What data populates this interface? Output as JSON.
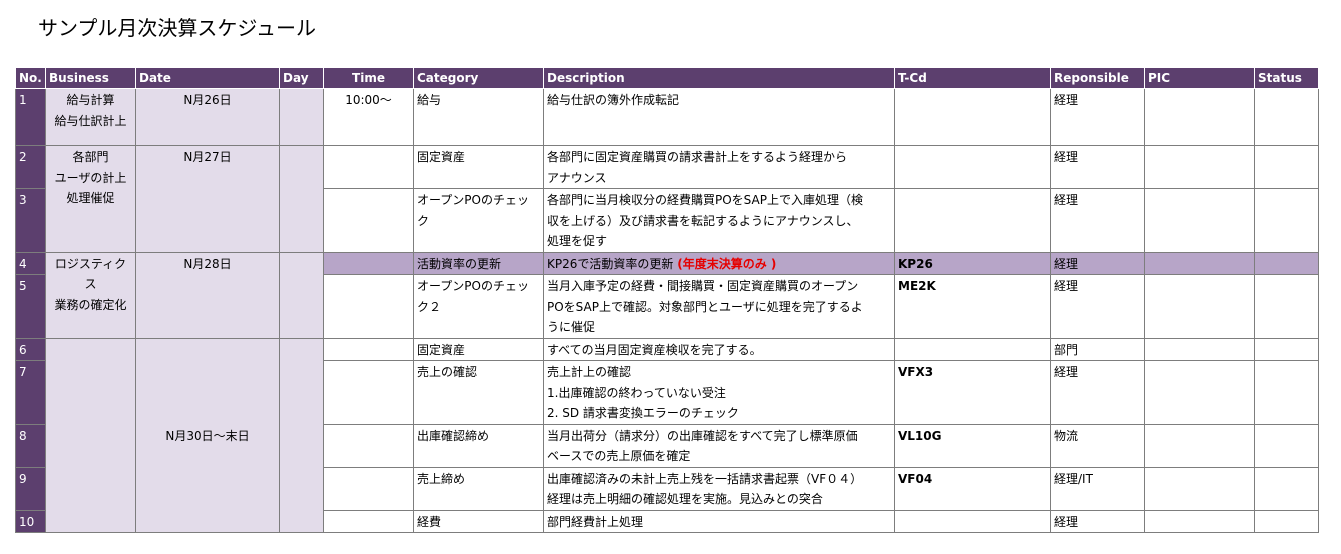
{
  "title": "サンプル月次決算スケジュール",
  "headers": {
    "no": "No.",
    "business": "Business",
    "date": "Date",
    "day": "Day",
    "time": "Time",
    "category": "Category",
    "description": "Description",
    "tcd": "T-Cd",
    "responsible": "Reponsible",
    "pic": "PIC",
    "status": "Status"
  },
  "business": {
    "g1": [
      "給与計算",
      "給与仕訳計上"
    ],
    "g2": [
      "各部門",
      "ユーザの計上",
      "処理催促"
    ],
    "g3": [
      "ロジスティク",
      "ス",
      "業務の確定化"
    ]
  },
  "dates": {
    "d1": "N月26日",
    "d2": "N月27日",
    "d3": "N月28日",
    "d4": "N月30日～末日"
  },
  "rows": [
    {
      "no": "1",
      "time": "10:00～",
      "category": [
        "給与"
      ],
      "description": [
        "給与仕訳の簿外作成転記"
      ],
      "tcd": "",
      "responsible": "経理"
    },
    {
      "no": "2",
      "time": "",
      "category": [
        "固定資産"
      ],
      "description": [
        "各部門に固定資産購買の請求書計上をするよう経理から",
        "アナウンス"
      ],
      "tcd": "",
      "responsible": "経理"
    },
    {
      "no": "3",
      "time": "",
      "category": [
        "オープンPOのチェッ",
        "ク"
      ],
      "description": [
        "各部門に当月検収分の経費購買POをSAP上で入庫処理（検",
        "収を上げる）及び請求書を転記するようにアナウンスし、",
        "処理を促す"
      ],
      "tcd": "",
      "responsible": "経理"
    },
    {
      "no": "4",
      "time": "",
      "category": [
        "活動資率の更新"
      ],
      "description_main": "KP26で活動資率の更新 ",
      "description_note": "(年度末決算のみ )",
      "tcd": "KP26",
      "responsible": "経理"
    },
    {
      "no": "5",
      "time": "",
      "category": [
        "オープンPOのチェッ",
        "ク２"
      ],
      "description": [
        "当月入庫予定の経費・間接購買・固定資産購買のオープン",
        "POをSAP上で確認。対象部門とユーザに処理を完了するよ",
        "うに催促"
      ],
      "tcd": "ME2K",
      "responsible": "経理"
    },
    {
      "no": "6",
      "time": "",
      "category": [
        "固定資産"
      ],
      "description": [
        "すべての当月固定資産検収を完了する。"
      ],
      "tcd": "",
      "responsible": "部門"
    },
    {
      "no": "7",
      "time": "",
      "category": [
        "売上の確認"
      ],
      "description": [
        "売上計上の確認",
        "1.出庫確認の終わっていない受注",
        "2. SD 請求書変換エラーのチェック"
      ],
      "tcd": "VFX3",
      "responsible": "経理"
    },
    {
      "no": "8",
      "time": "",
      "category": [
        "出庫確認締め"
      ],
      "description": [
        "当月出荷分（請求分）の出庫確認をすべて完了し標準原価",
        "ベースでの売上原価を確定"
      ],
      "tcd": "VL10G",
      "responsible": "物流"
    },
    {
      "no": "9",
      "time": "",
      "category": [
        "売上締め"
      ],
      "description": [
        "出庫確認済みの未計上売上残を一括請求書起票（VF０４）",
        "経理は売上明細の確認処理を実施。見込みとの突合"
      ],
      "tcd": "VF04",
      "responsible": "経理/IT"
    },
    {
      "no": "10",
      "time": "",
      "category": [
        "経費"
      ],
      "description": [
        "部門経費計上処理"
      ],
      "tcd": "",
      "responsible": "経理"
    }
  ]
}
